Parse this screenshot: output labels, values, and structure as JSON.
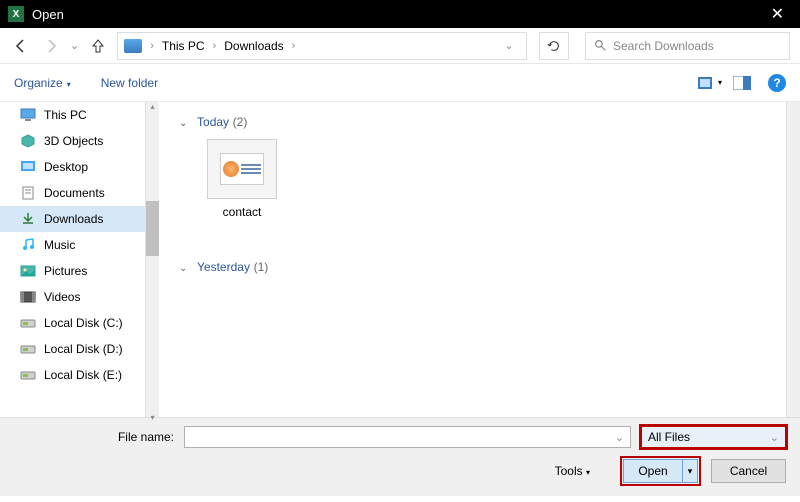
{
  "title": "Open",
  "breadcrumb": {
    "root": "This PC",
    "current": "Downloads",
    "sep": "›"
  },
  "search": {
    "placeholder": "Search Downloads"
  },
  "toolbar": {
    "organize": "Organize",
    "new_folder": "New folder",
    "help": "?"
  },
  "sidebar": {
    "items": [
      {
        "label": "This PC",
        "icon": "thispc",
        "selected": false
      },
      {
        "label": "3D Objects",
        "icon": "3d",
        "selected": false
      },
      {
        "label": "Desktop",
        "icon": "desktop",
        "selected": false
      },
      {
        "label": "Documents",
        "icon": "documents",
        "selected": false
      },
      {
        "label": "Downloads",
        "icon": "downloads",
        "selected": true
      },
      {
        "label": "Music",
        "icon": "music",
        "selected": false
      },
      {
        "label": "Pictures",
        "icon": "pictures",
        "selected": false
      },
      {
        "label": "Videos",
        "icon": "videos",
        "selected": false
      },
      {
        "label": "Local Disk (C:)",
        "icon": "disk",
        "selected": false
      },
      {
        "label": "Local Disk (D:)",
        "icon": "disk",
        "selected": false
      },
      {
        "label": "Local Disk (E:)",
        "icon": "disk",
        "selected": false
      }
    ]
  },
  "content": {
    "groups": [
      {
        "label": "Today",
        "count": "(2)",
        "files": [
          {
            "name": "contact"
          }
        ]
      },
      {
        "label": "Yesterday",
        "count": "(1)",
        "files": []
      }
    ]
  },
  "footer": {
    "filename_label": "File name:",
    "filetype": "All Files",
    "tools": "Tools",
    "open": "Open",
    "cancel": "Cancel"
  }
}
